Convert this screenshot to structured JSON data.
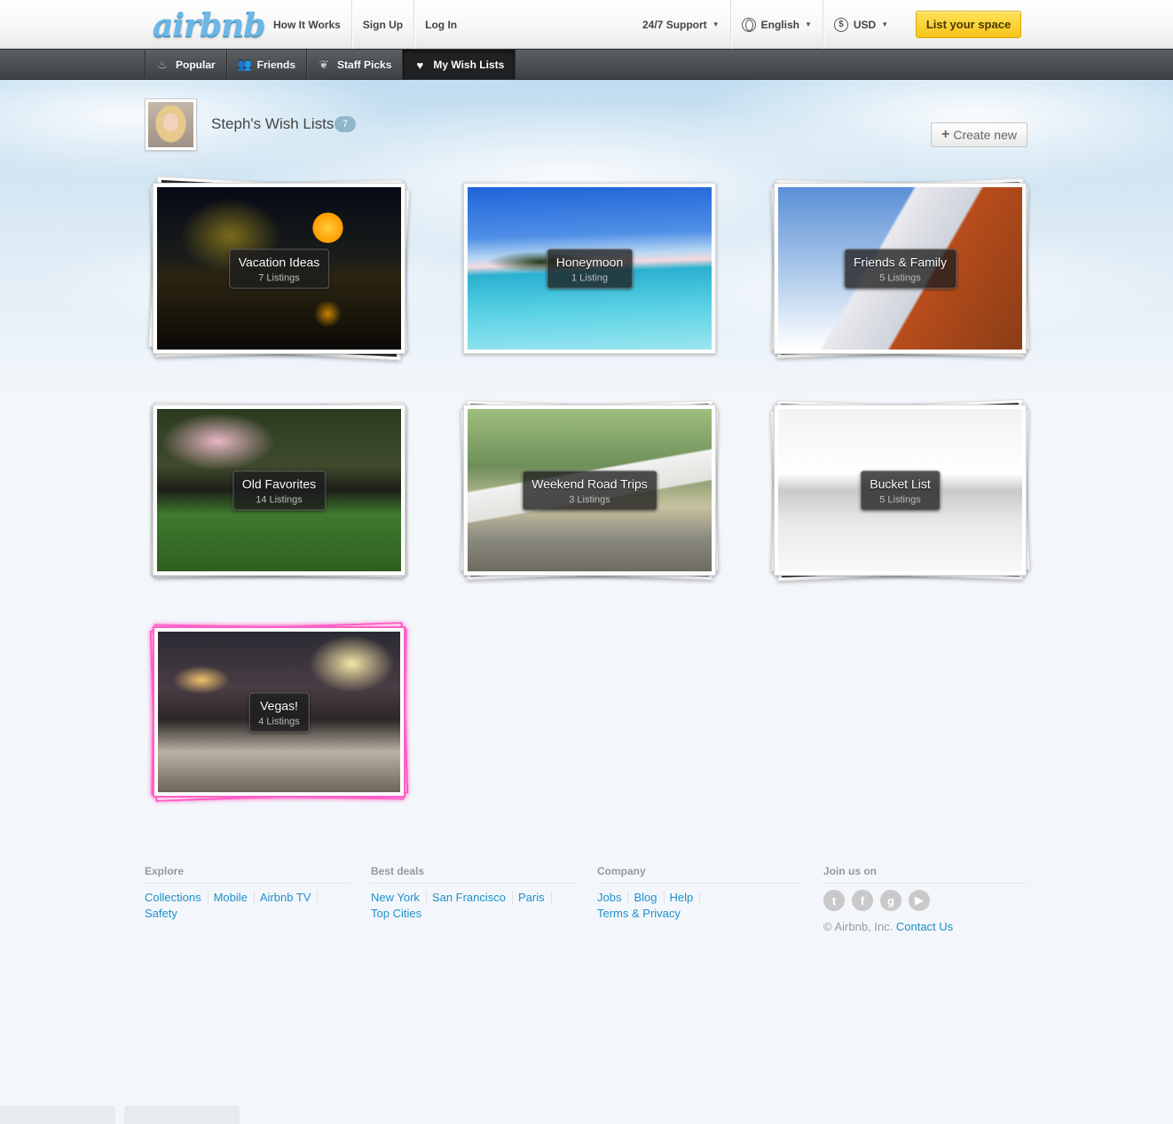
{
  "logo": "airbnb",
  "header": {
    "nav_left": [
      "How It Works",
      "Sign Up",
      "Log In"
    ],
    "support": "24/7 Support",
    "language": "English",
    "currency": "USD",
    "currency_symbol": "$",
    "cta": "List your space"
  },
  "subnav": {
    "tabs": [
      {
        "label": "Popular",
        "icon": "flame-icon"
      },
      {
        "label": "Friends",
        "icon": "people-icon"
      },
      {
        "label": "Staff Picks",
        "icon": "leaf-icon"
      },
      {
        "label": "My Wish Lists",
        "icon": "heart-icon",
        "active": true
      }
    ]
  },
  "wishlists": {
    "title": "Steph's Wish Lists",
    "count": "7",
    "create_label": "Create new",
    "items": [
      {
        "name": "Vacation Ideas",
        "count": "7 Listings"
      },
      {
        "name": "Honeymoon",
        "count": "1 Listing"
      },
      {
        "name": "Friends & Family",
        "count": "5 Listings"
      },
      {
        "name": "Old Favorites",
        "count": "14 Listings"
      },
      {
        "name": "Weekend Road Trips",
        "count": "3 Listings"
      },
      {
        "name": "Bucket List",
        "count": "5 Listings"
      },
      {
        "name": "Vegas!",
        "count": "4 Listings"
      }
    ]
  },
  "footer": {
    "explore": {
      "title": "Explore",
      "links": [
        "Collections",
        "Mobile",
        "Airbnb TV",
        "Safety"
      ]
    },
    "deals": {
      "title": "Best deals",
      "links": [
        "New York",
        "San Francisco",
        "Paris",
        "Top Cities"
      ]
    },
    "company": {
      "title": "Company",
      "links": [
        "Jobs",
        "Blog",
        "Help",
        "Terms & Privacy"
      ]
    },
    "join": {
      "title": "Join us on",
      "social": [
        "twitter-icon",
        "facebook-icon",
        "google-plus-icon",
        "youtube-icon"
      ]
    },
    "copyright": "© Airbnb, Inc.",
    "contact": "Contact Us"
  },
  "colors": {
    "accent": "#1f8fc9",
    "cta": "#f7c519",
    "highlight": "#ff62c6"
  }
}
